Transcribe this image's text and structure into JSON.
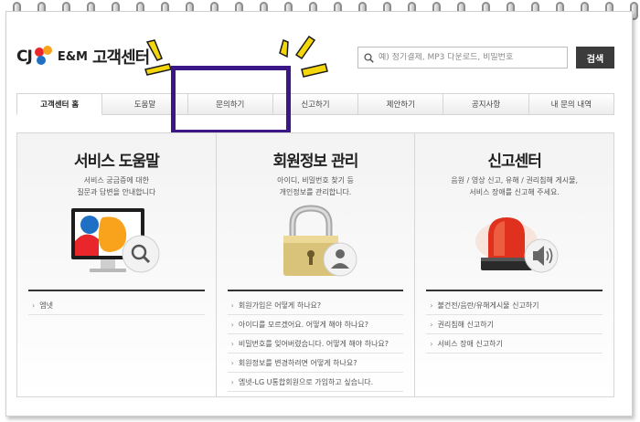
{
  "header": {
    "logo_cj": "CJ",
    "logo_em": "E&M",
    "logo_title": "고객센터",
    "search_placeholder": "예) 정기결제, MP3 다운로드, 비밀번호",
    "search_button": "검색"
  },
  "nav": {
    "items": [
      {
        "label": "고객센터 홈"
      },
      {
        "label": "도움말"
      },
      {
        "label": "문의하기"
      },
      {
        "label": "신고하기"
      },
      {
        "label": "제안하기"
      },
      {
        "label": "공지사항"
      },
      {
        "label": "내 문의 내역"
      }
    ]
  },
  "sections": [
    {
      "title": "서비스 도움말",
      "desc": [
        "서비스 궁금증에 대한",
        "질문과 답변을 안내합니다"
      ],
      "icon": "monitor-search-icon",
      "links": [
        "엠넷"
      ]
    },
    {
      "title": "회원정보 관리",
      "desc": [
        "아이디, 비밀번호 찾기 등",
        "개인정보를 관리합니다."
      ],
      "icon": "padlock-user-icon",
      "links": [
        "회원가입은 어떻게 하나요?",
        "아이디를 모르겠어요. 어떻게 해야 하나요?",
        "비밀번호를 잊어버렸습니다. 어떻게 해야 하나요?",
        "회원정보를 변경하려면 어떻게 하나요?",
        "엠넷-LG U통합회원으로 가입하고 싶습니다."
      ]
    },
    {
      "title": "신고센터",
      "desc": [
        "음원 / 영상 신고, 유해 / 권리침해 게시물,",
        "서비스 장애를 신고해 주세요."
      ],
      "icon": "siren-speaker-icon",
      "links": [
        "불건전/음란/유해게시물 신고하기",
        "권리침해 신고하기",
        "서비스 장애 신고하기"
      ]
    }
  ],
  "colors": {
    "highlight": "#3b1687",
    "burst": "#f5d60a",
    "search_button": "#3b3b3b"
  }
}
